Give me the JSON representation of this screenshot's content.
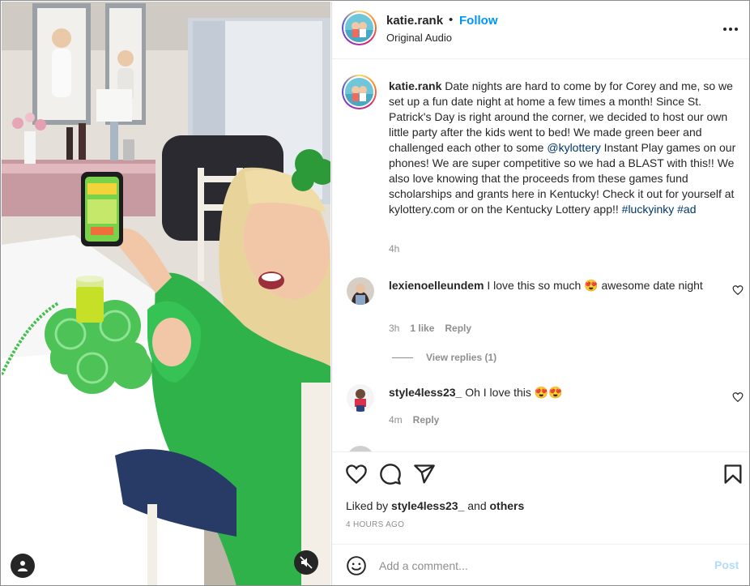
{
  "header": {
    "username": "katie.rank",
    "separator": "•",
    "follow_label": "Follow",
    "audio_label": "Original Audio"
  },
  "caption": {
    "username": "katie.rank",
    "text_part1": "Date nights are hard to come by for Corey and me, so we set up a fun date night at home a few times a month! Since St. Patrick's Day is right around the corner, we decided to host our own little party after the kids went to bed! We made green beer and challenged each other to some ",
    "mention": "@kylottery",
    "text_part2": " Instant Play games on our phones! We are super competitive so we had a BLAST with this!! We also love knowing that the proceeds from these games fund scholarships and grants here in Kentucky! Check it out for yourself at kylottery.com or on the Kentucky Lottery app!! ",
    "hashtag1": "#luckyinky",
    "hashtag2": "#ad",
    "time": "4h"
  },
  "comments": [
    {
      "username": "lexienoelleundem",
      "text": "I love this so much 😍 awesome date night",
      "time": "3h",
      "likes": "1 like",
      "reply_label": "Reply"
    },
    {
      "username": "style4less23_",
      "text": "Oh I love this 😍😍",
      "time": "4m",
      "reply_label": "Reply"
    }
  ],
  "view_replies_label": "View replies (1)",
  "actions": {
    "like_icon": "heart-icon",
    "comment_icon": "comment-icon",
    "share_icon": "paper-plane-icon",
    "save_icon": "bookmark-icon"
  },
  "likes": {
    "prefix": "Liked by",
    "user": "style4less23_",
    "joiner": "and",
    "others": "others"
  },
  "post_date": "4 HOURS AGO",
  "add_comment": {
    "placeholder": "Add a comment...",
    "post_label": "Post"
  },
  "colors": {
    "follow": "#0095f6",
    "link": "#00376b",
    "muted": "#8e8e8e",
    "post_disabled": "#b3dbff"
  }
}
